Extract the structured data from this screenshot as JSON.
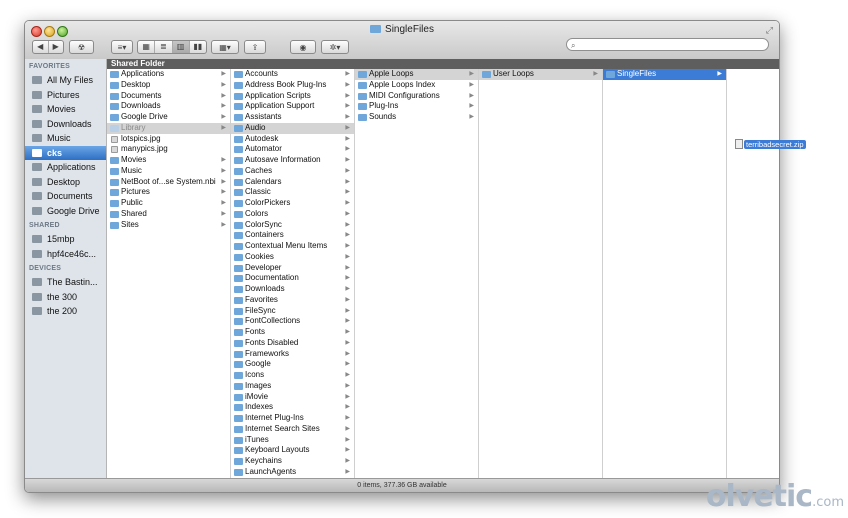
{
  "window": {
    "title": "SingleFiles"
  },
  "toolbar": {
    "search_placeholder": ""
  },
  "sidebar": {
    "favorites_label": "FAVORITES",
    "favorites": [
      "All My Files",
      "Pictures",
      "Movies",
      "Downloads",
      "Music",
      "cks",
      "Applications",
      "Desktop",
      "Documents",
      "Google Drive"
    ],
    "selected": "cks",
    "shared_label": "SHARED",
    "shared": [
      "15mbp",
      "hpf4ce46c..."
    ],
    "devices_label": "DEVICES",
    "devices": [
      "The Bastin...",
      "the 300",
      "the 200"
    ]
  },
  "header": {
    "title": "Shared Folder"
  },
  "columns": {
    "col1": [
      {
        "label": "Applications",
        "type": "folder",
        "arrow": true
      },
      {
        "label": "Desktop",
        "type": "folder",
        "arrow": true
      },
      {
        "label": "Documents",
        "type": "folder",
        "arrow": true
      },
      {
        "label": "Downloads",
        "type": "folder",
        "arrow": true
      },
      {
        "label": "Google Drive",
        "type": "folder",
        "arrow": true
      },
      {
        "label": "Library",
        "type": "folder",
        "arrow": true,
        "state": "selected-gray",
        "dim": true
      },
      {
        "label": "lotspics.jpg",
        "type": "file",
        "arrow": false
      },
      {
        "label": "manypics.jpg",
        "type": "file",
        "arrow": false
      },
      {
        "label": "Movies",
        "type": "folder",
        "arrow": true
      },
      {
        "label": "Music",
        "type": "folder",
        "arrow": true
      },
      {
        "label": "NetBoot of...se System.nbi",
        "type": "folder",
        "arrow": true
      },
      {
        "label": "Pictures",
        "type": "folder",
        "arrow": true
      },
      {
        "label": "Public",
        "type": "folder",
        "arrow": true
      },
      {
        "label": "Shared",
        "type": "folder",
        "arrow": true
      },
      {
        "label": "Sites",
        "type": "folder",
        "arrow": true
      }
    ],
    "col2": [
      {
        "label": "Accounts",
        "type": "folder",
        "arrow": true
      },
      {
        "label": "Address Book Plug-Ins",
        "type": "folder",
        "arrow": true
      },
      {
        "label": "Application Scripts",
        "type": "folder",
        "arrow": true
      },
      {
        "label": "Application Support",
        "type": "folder",
        "arrow": true
      },
      {
        "label": "Assistants",
        "type": "folder",
        "arrow": true
      },
      {
        "label": "Audio",
        "type": "folder",
        "arrow": true,
        "state": "selected-gray"
      },
      {
        "label": "Autodesk",
        "type": "folder",
        "arrow": true
      },
      {
        "label": "Automator",
        "type": "folder",
        "arrow": true
      },
      {
        "label": "Autosave Information",
        "type": "folder",
        "arrow": true
      },
      {
        "label": "Caches",
        "type": "folder",
        "arrow": true
      },
      {
        "label": "Calendars",
        "type": "folder",
        "arrow": true
      },
      {
        "label": "Classic",
        "type": "folder",
        "arrow": true
      },
      {
        "label": "ColorPickers",
        "type": "folder",
        "arrow": true
      },
      {
        "label": "Colors",
        "type": "folder",
        "arrow": true
      },
      {
        "label": "ColorSync",
        "type": "folder",
        "arrow": true
      },
      {
        "label": "Containers",
        "type": "folder",
        "arrow": true
      },
      {
        "label": "Contextual Menu Items",
        "type": "folder",
        "arrow": true
      },
      {
        "label": "Cookies",
        "type": "folder",
        "arrow": true
      },
      {
        "label": "Developer",
        "type": "folder",
        "arrow": true
      },
      {
        "label": "Documentation",
        "type": "folder",
        "arrow": true
      },
      {
        "label": "Downloads",
        "type": "folder",
        "arrow": true
      },
      {
        "label": "Favorites",
        "type": "folder",
        "arrow": true
      },
      {
        "label": "FileSync",
        "type": "folder",
        "arrow": true
      },
      {
        "label": "FontCollections",
        "type": "folder",
        "arrow": true
      },
      {
        "label": "Fonts",
        "type": "folder",
        "arrow": true
      },
      {
        "label": "Fonts Disabled",
        "type": "folder",
        "arrow": true
      },
      {
        "label": "Frameworks",
        "type": "folder",
        "arrow": true
      },
      {
        "label": "Google",
        "type": "folder",
        "arrow": true
      },
      {
        "label": "Icons",
        "type": "folder",
        "arrow": true
      },
      {
        "label": "Images",
        "type": "folder",
        "arrow": true
      },
      {
        "label": "iMovie",
        "type": "folder",
        "arrow": true
      },
      {
        "label": "Indexes",
        "type": "folder",
        "arrow": true
      },
      {
        "label": "Internet Plug-Ins",
        "type": "folder",
        "arrow": true
      },
      {
        "label": "Internet Search Sites",
        "type": "folder",
        "arrow": true
      },
      {
        "label": "iTunes",
        "type": "folder",
        "arrow": true
      },
      {
        "label": "Keyboard Layouts",
        "type": "folder",
        "arrow": true
      },
      {
        "label": "Keychains",
        "type": "folder",
        "arrow": true
      },
      {
        "label": "LaunchAgents",
        "type": "folder",
        "arrow": true
      }
    ],
    "col3": [
      {
        "label": "Apple Loops",
        "type": "folder",
        "arrow": true,
        "state": "selected-gray"
      },
      {
        "label": "Apple Loops Index",
        "type": "folder",
        "arrow": true
      },
      {
        "label": "MIDI Configurations",
        "type": "folder",
        "arrow": true
      },
      {
        "label": "Plug-Ins",
        "type": "folder",
        "arrow": true
      },
      {
        "label": "Sounds",
        "type": "folder",
        "arrow": true
      }
    ],
    "col4": [
      {
        "label": "User Loops",
        "type": "folder",
        "arrow": true,
        "state": "selected-gray"
      }
    ],
    "col5": [
      {
        "label": "SingleFiles",
        "type": "folder",
        "arrow": true,
        "state": "selected-blue"
      }
    ],
    "col6": []
  },
  "status": {
    "text": "0 items, 377.36 GB available"
  },
  "drag": {
    "filename": "terribadsecret.zip"
  },
  "watermark": {
    "main": "olvetic",
    "suffix": ".com"
  }
}
